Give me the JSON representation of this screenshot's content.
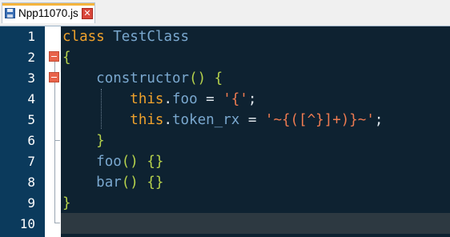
{
  "tab": {
    "filename": "Npp11070.js",
    "close_symbol": "✕",
    "accent_color": "#f4b43d"
  },
  "editor": {
    "line_numbers": [
      "1",
      "2",
      "3",
      "4",
      "5",
      "6",
      "7",
      "8",
      "9",
      "10"
    ],
    "current_line": 10,
    "colors": {
      "background": "#0e2231",
      "gutter": "#0b3a5c",
      "keyword": "#f0a22c",
      "identifier": "#7aa8cf",
      "brace": "#b6d24c",
      "string": "#ef7b51"
    },
    "code": {
      "l1_kw": "class",
      "l1_name": "TestClass",
      "l2_brace": "{",
      "l3_name": "constructor",
      "l3_brace": "() {",
      "l4_this": "this",
      "l4_dot": ".",
      "l4_prop": "foo",
      "l4_eq": " = ",
      "l4_str": "'{'",
      "l4_semi": ";",
      "l5_this": "this",
      "l5_dot": ".",
      "l5_prop": "token_rx",
      "l5_eq": " = ",
      "l5_str": "'~{([^}]+)}~'",
      "l5_semi": ";",
      "l6_brace": "}",
      "l7_name": "foo",
      "l7_brace": "() {}",
      "l8_name": "bar",
      "l8_brace": "() {}",
      "l9_brace": "}"
    }
  }
}
